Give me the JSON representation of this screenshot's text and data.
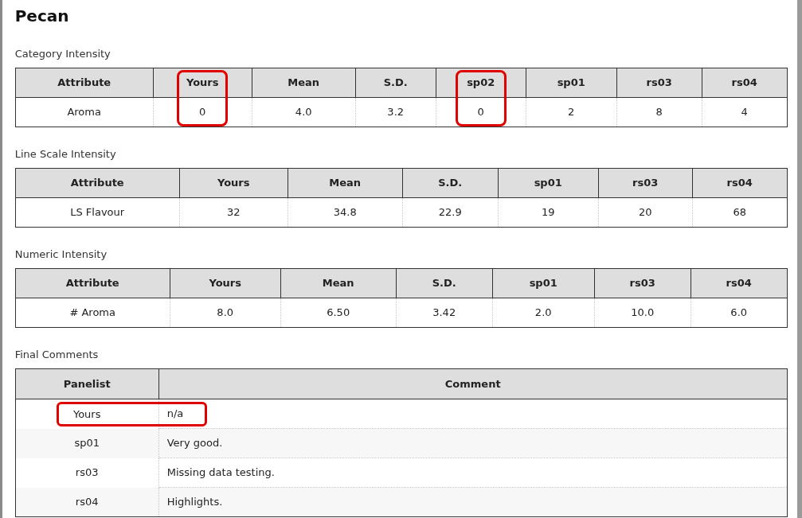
{
  "title": "Pecan",
  "sections": [
    {
      "kind": "scores",
      "heading": "Category Intensity",
      "columns": [
        {
          "label": "Attribute",
          "highlighted": false
        },
        {
          "label": "Yours",
          "highlighted": true
        },
        {
          "label": "Mean",
          "highlighted": false
        },
        {
          "label": "S.D.",
          "highlighted": false
        },
        {
          "label": "sp02",
          "highlighted": true
        },
        {
          "label": "sp01",
          "highlighted": false
        },
        {
          "label": "rs03",
          "highlighted": false
        },
        {
          "label": "rs04",
          "highlighted": false
        }
      ],
      "rows": [
        [
          "Aroma",
          "0",
          "4.0",
          "3.2",
          "0",
          "2",
          "8",
          "4"
        ]
      ]
    },
    {
      "kind": "scores",
      "heading": "Line Scale Intensity",
      "columns": [
        {
          "label": "Attribute",
          "highlighted": false
        },
        {
          "label": "Yours",
          "highlighted": false
        },
        {
          "label": "Mean",
          "highlighted": false
        },
        {
          "label": "S.D.",
          "highlighted": false
        },
        {
          "label": "sp01",
          "highlighted": false
        },
        {
          "label": "rs03",
          "highlighted": false
        },
        {
          "label": "rs04",
          "highlighted": false
        }
      ],
      "rows": [
        [
          "LS Flavour",
          "32",
          "34.8",
          "22.9",
          "19",
          "20",
          "68"
        ]
      ]
    },
    {
      "kind": "scores",
      "heading": "Numeric Intensity",
      "columns": [
        {
          "label": "Attribute",
          "highlighted": false
        },
        {
          "label": "Yours",
          "highlighted": false
        },
        {
          "label": "Mean",
          "highlighted": false
        },
        {
          "label": "S.D.",
          "highlighted": false
        },
        {
          "label": "sp01",
          "highlighted": false
        },
        {
          "label": "rs03",
          "highlighted": false
        },
        {
          "label": "rs04",
          "highlighted": false
        }
      ],
      "rows": [
        [
          "# Aroma",
          "8.0",
          "6.50",
          "3.42",
          "2.0",
          "10.0",
          "6.0"
        ]
      ]
    },
    {
      "kind": "comments",
      "heading": "Final Comments",
      "columns": [
        {
          "label": "Panelist"
        },
        {
          "label": "Comment"
        }
      ],
      "rows": [
        {
          "panelist": "Yours",
          "comment": "n/a",
          "highlighted": true
        },
        {
          "panelist": "sp01",
          "comment": "Very good.",
          "highlighted": false
        },
        {
          "panelist": "rs03",
          "comment": "Missing data testing.",
          "highlighted": false
        },
        {
          "panelist": "rs04",
          "comment": "Highlights.",
          "highlighted": false
        }
      ]
    }
  ]
}
